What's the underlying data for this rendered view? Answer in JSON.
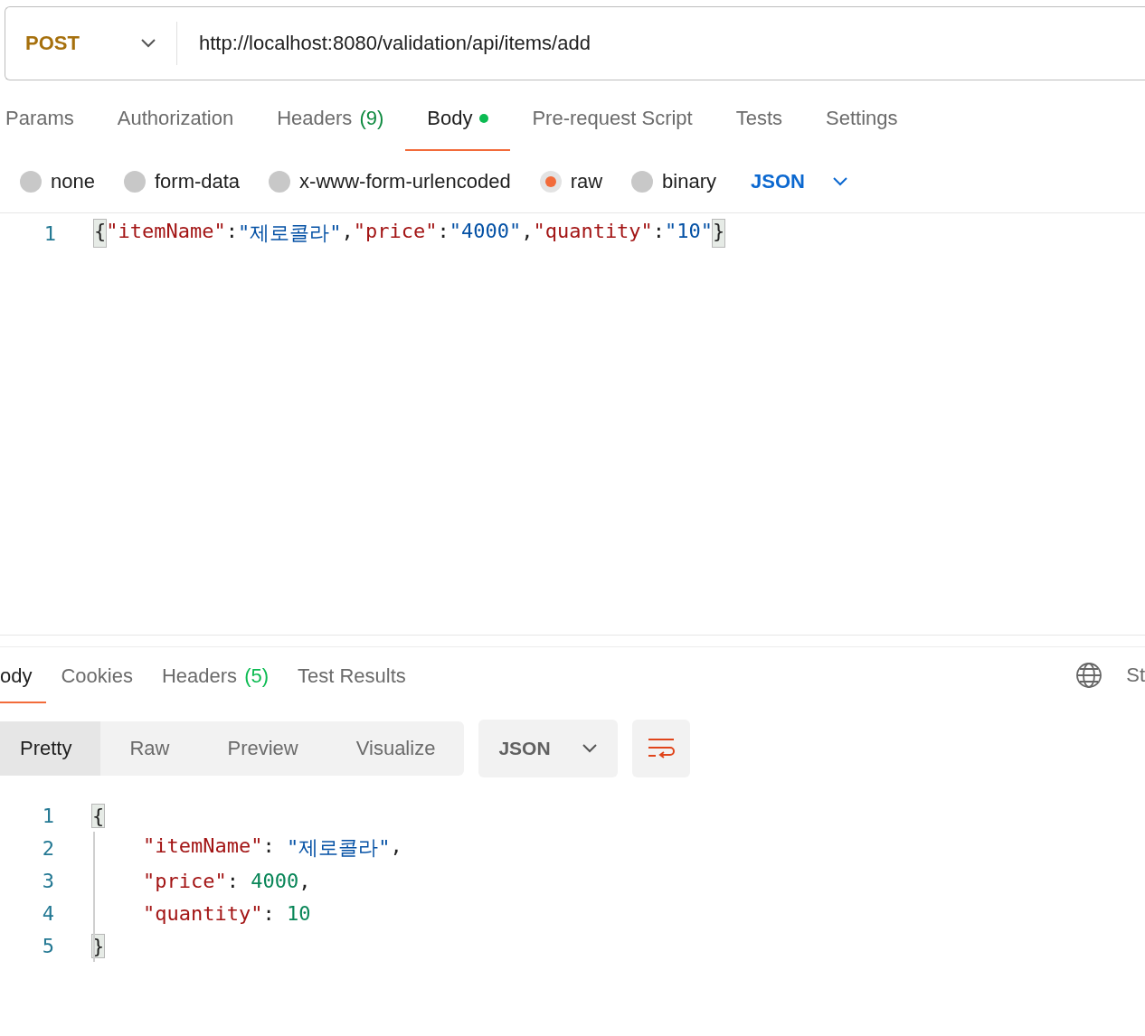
{
  "request": {
    "method": "POST",
    "url": "http://localhost:8080/validation/api/items/add"
  },
  "request_tabs": [
    {
      "label": "Params",
      "selected": false,
      "modified": false
    },
    {
      "label": "Authorization",
      "selected": false,
      "modified": false
    },
    {
      "label": "Headers",
      "count": "(9)",
      "selected": false,
      "modified": false
    },
    {
      "label": "Body",
      "selected": true,
      "modified": true
    },
    {
      "label": "Pre-request Script",
      "selected": false,
      "modified": false
    },
    {
      "label": "Tests",
      "selected": false,
      "modified": false
    },
    {
      "label": "Settings",
      "selected": false,
      "modified": false
    }
  ],
  "body_types": [
    {
      "label": "none",
      "selected": false
    },
    {
      "label": "form-data",
      "selected": false
    },
    {
      "label": "x-www-form-urlencoded",
      "selected": false
    },
    {
      "label": "raw",
      "selected": true
    },
    {
      "label": "binary",
      "selected": false
    }
  ],
  "body_format": "JSON",
  "request_body": [
    {
      "number": "1",
      "indented": false,
      "tokens": [
        {
          "kind": "brace",
          "text": "{"
        },
        {
          "kind": "key",
          "text": "\"itemName\""
        },
        {
          "kind": "punct",
          "text": ":"
        },
        {
          "kind": "string",
          "text": "\"제로콜라\""
        },
        {
          "kind": "punct",
          "text": ","
        },
        {
          "kind": "key",
          "text": "\"price\""
        },
        {
          "kind": "punct",
          "text": ":"
        },
        {
          "kind": "string",
          "text": "\"4000\""
        },
        {
          "kind": "punct",
          "text": ","
        },
        {
          "kind": "key",
          "text": "\"quantity\""
        },
        {
          "kind": "punct",
          "text": ":"
        },
        {
          "kind": "string",
          "text": "\"10\""
        },
        {
          "kind": "brace",
          "text": "}"
        }
      ]
    }
  ],
  "response_tabs": [
    {
      "label": "ody",
      "selected": true
    },
    {
      "label": "Cookies",
      "selected": false
    },
    {
      "label": "Headers",
      "count": "(5)",
      "selected": false
    },
    {
      "label": "Test Results",
      "selected": false
    }
  ],
  "response_status_label": "St",
  "view_modes": [
    {
      "label": "Pretty",
      "selected": true
    },
    {
      "label": "Raw",
      "selected": false
    },
    {
      "label": "Preview",
      "selected": false
    },
    {
      "label": "Visualize",
      "selected": false
    }
  ],
  "response_format": "JSON",
  "response_body": [
    {
      "number": "1",
      "indented": false,
      "tokens": [
        {
          "kind": "brace",
          "text": "{"
        }
      ]
    },
    {
      "number": "2",
      "indented": true,
      "tokens": [
        {
          "kind": "key",
          "text": "\"itemName\""
        },
        {
          "kind": "punct",
          "text": ": "
        },
        {
          "kind": "string",
          "text": "\"제로콜라\""
        },
        {
          "kind": "punct",
          "text": ","
        }
      ]
    },
    {
      "number": "3",
      "indented": true,
      "tokens": [
        {
          "kind": "key",
          "text": "\"price\""
        },
        {
          "kind": "punct",
          "text": ": "
        },
        {
          "kind": "number",
          "text": "4000"
        },
        {
          "kind": "punct",
          "text": ","
        }
      ]
    },
    {
      "number": "4",
      "indented": true,
      "tokens": [
        {
          "kind": "key",
          "text": "\"quantity\""
        },
        {
          "kind": "punct",
          "text": ": "
        },
        {
          "kind": "number",
          "text": "10"
        }
      ]
    },
    {
      "number": "5",
      "indented": false,
      "tokens": [
        {
          "kind": "brace",
          "text": "}"
        }
      ]
    }
  ]
}
